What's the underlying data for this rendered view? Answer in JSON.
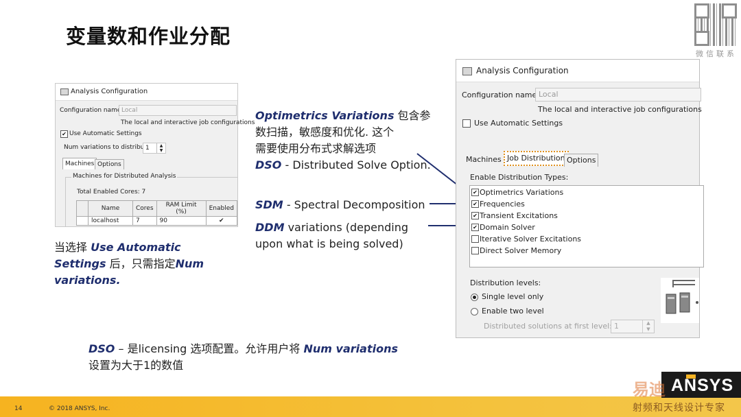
{
  "slide": {
    "title": "变量数和作业分配",
    "qr_caption": "微信联系",
    "page_number": "14",
    "copyright": "© 2018 ANSYS, Inc.",
    "brand": "ANSYS",
    "watermark": "射频和天线设计专家",
    "watermark_logo_text": "易迪",
    "accent_color": "#f5b324",
    "navy_color": "#1f2e6e"
  },
  "small_dialog": {
    "title": "Analysis Configuration",
    "config_name_label": "Configuration name:",
    "config_name_value": "Local",
    "config_desc": "The local and interactive job configurations",
    "use_auto_label": "Use Automatic Settings",
    "use_auto_checked": "✔",
    "num_var_label": "Num variations to distribute:",
    "num_var_value": "1",
    "tabs": [
      "Machines",
      "Options"
    ],
    "group_label": "Machines for Distributed Analysis",
    "total_cores": "Total Enabled Cores: 7",
    "table": {
      "headers": [
        "Name",
        "Cores",
        "RAM Limit (%)",
        "Enabled"
      ],
      "row": [
        "localhost",
        "7",
        "90",
        "✔"
      ]
    }
  },
  "big_dialog": {
    "title": "Analysis Configuration",
    "config_name_label": "Configuration name:",
    "config_name_placeholder": "Local",
    "config_desc": "The local and interactive job configurations",
    "use_auto_label": "Use Automatic Settings",
    "tabs": [
      "Machines",
      "Job Distribution",
      "Options"
    ],
    "enable_types_label": "Enable Distribution Types:",
    "types": [
      {
        "label": "Optimetrics Variations",
        "checked": "✔"
      },
      {
        "label": "Frequencies",
        "checked": "✔"
      },
      {
        "label": "Transient Excitations",
        "checked": "✔"
      },
      {
        "label": "Domain Solver",
        "checked": "✔"
      },
      {
        "label": "Iterative Solver Excitations",
        "checked": ""
      },
      {
        "label": "Direct Solver Memory",
        "checked": ""
      }
    ],
    "dist_levels_label": "Distribution levels:",
    "single_level": "Single level only",
    "two_level": "Enable two level",
    "first_level_label": "Distributed solutions at first level:",
    "first_level_value": "1"
  },
  "annotations": {
    "optimetrics_term": "Optimetrics Variations",
    "optimetrics_text1": " 包含参",
    "optimetrics_text2": "数扫描，敏感度和优化. 这个",
    "optimetrics_text3": "需要使用分布式求解选项",
    "dso_term": "DSO",
    "dso_text": " - Distributed Solve Option.",
    "sdm_term": "SDM",
    "sdm_text": " - Spectral Decomposition",
    "ddm_term": "DDM",
    "ddm_text1": " variations (depending",
    "ddm_text2": "upon what is being solved)",
    "auto_text1": "当选择 ",
    "auto_term1": "Use Automatic",
    "auto_term2": "Settings",
    "auto_text2": " 后，只需指定",
    "auto_term3": "Num",
    "auto_term4": "variations.",
    "bottom_term1": "DSO",
    "bottom_text1": " – 是licensing 选项配置。允许用户将 ",
    "bottom_term2": "Num variations",
    "bottom_text2": "设置为大于1的数值"
  }
}
